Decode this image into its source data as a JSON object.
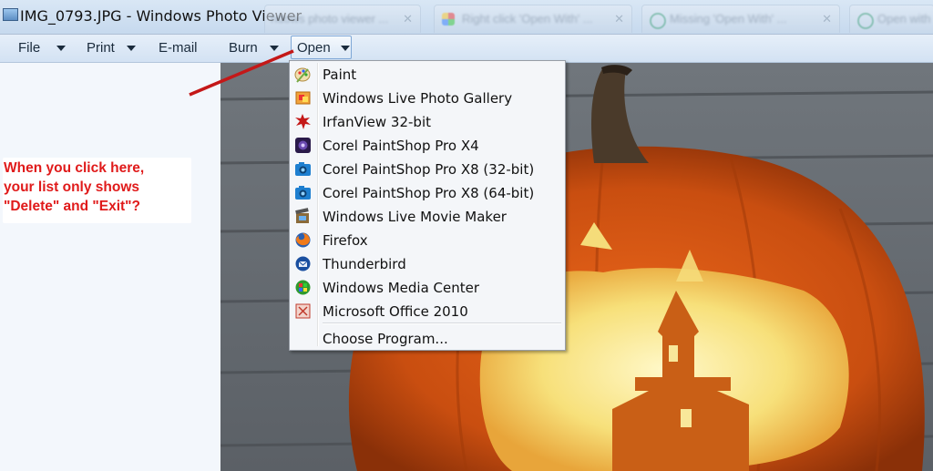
{
  "window": {
    "title": "IMG_0793.JPG - Windows Photo Viewer"
  },
  "background_tabs": [
    {
      "label": "ndows photo viewer ..."
    },
    {
      "label": "Right click 'Open With' ..."
    },
    {
      "label": "Missing 'Open With' ..."
    },
    {
      "label": "Open with ..."
    }
  ],
  "menubar": {
    "file": "File",
    "print": "Print",
    "email": "E-mail",
    "burn": "Burn",
    "open": "Open"
  },
  "annotation": {
    "text": "When you click here,\nyour list only shows\n\"Delete\" and \"Exit\"?",
    "color": "#e01a1a"
  },
  "open_menu": {
    "items": [
      {
        "label": "Paint",
        "icon": "paint-icon"
      },
      {
        "label": "Windows Live Photo Gallery",
        "icon": "photo-gallery-icon"
      },
      {
        "label": "IrfanView 32-bit",
        "icon": "irfanview-icon"
      },
      {
        "label": "Corel PaintShop Pro X4",
        "icon": "paintshop-x4-icon"
      },
      {
        "label": "Corel PaintShop Pro X8 (32-bit)",
        "icon": "paintshop-x8-icon"
      },
      {
        "label": "Corel PaintShop Pro X8 (64-bit)",
        "icon": "paintshop-x8-icon"
      },
      {
        "label": "Windows Live Movie Maker",
        "icon": "movie-maker-icon"
      },
      {
        "label": "Firefox",
        "icon": "firefox-icon"
      },
      {
        "label": "Thunderbird",
        "icon": "thunderbird-icon"
      },
      {
        "label": "Windows Media Center",
        "icon": "media-center-icon"
      },
      {
        "label": "Microsoft Office 2010",
        "icon": "office-icon"
      }
    ],
    "choose_program": "Choose Program..."
  }
}
